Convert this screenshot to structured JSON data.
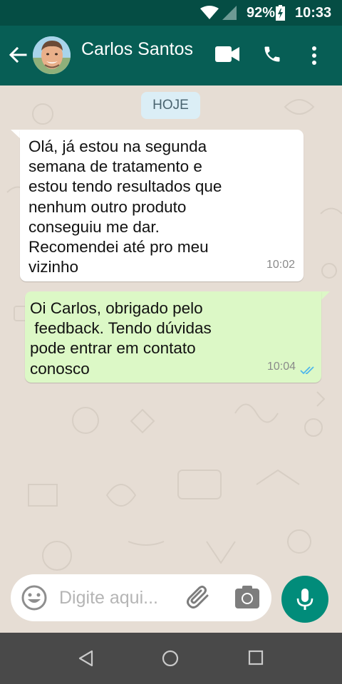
{
  "status_bar": {
    "battery": "92%",
    "time": "10:33"
  },
  "header": {
    "contact_name": "Carlos Santos"
  },
  "chat": {
    "date_label": "HOJE",
    "messages": [
      {
        "direction": "incoming",
        "text": "Olá, já estou na segunda\nsemana de tratamento e\nestou tendo resultados que\nnenhum outro produto\nconseguiu me dar.\nRecomendei até pro meu\nvizinho",
        "time": "10:02"
      },
      {
        "direction": "outgoing",
        "text": "Oi Carlos, obrigado pelo\n feedback. Tendo dúvidas\npode entrar em contato\nconosco",
        "time": "10:04",
        "status": "read"
      }
    ]
  },
  "composer": {
    "placeholder": "Digite aqui..."
  },
  "colors": {
    "header": "#075e55",
    "status_bar": "#054d44",
    "incoming_bubble": "#ffffff",
    "outgoing_bubble": "#dcf8c6",
    "mic_button": "#018c7a",
    "read_ticks": "#4fb6ec"
  },
  "icons": [
    "wifi-icon",
    "signal-icon",
    "battery-icon",
    "back-arrow-icon",
    "video-call-icon",
    "phone-icon",
    "more-options-icon",
    "emoji-icon",
    "attach-icon",
    "camera-icon",
    "mic-icon",
    "double-check-icon",
    "nav-back-icon",
    "nav-home-icon",
    "nav-recent-icon"
  ]
}
